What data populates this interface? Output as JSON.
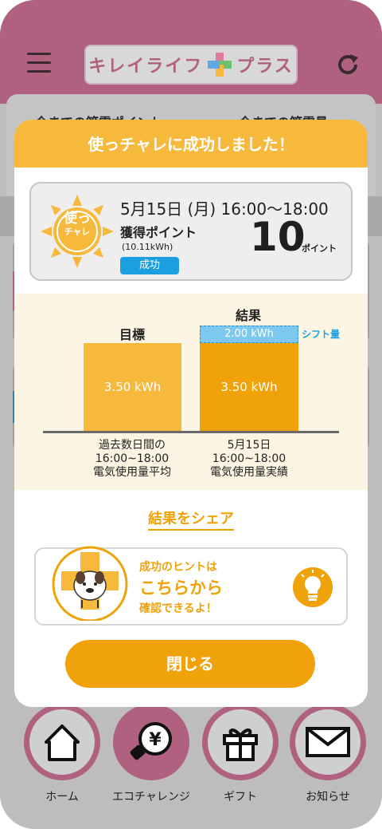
{
  "header": {
    "logo_text_left": "キレイライフ",
    "logo_text_right": "プラス"
  },
  "background": {
    "tab_left": "今までの節電ポイント",
    "tab_right": "今までの節電量"
  },
  "modal": {
    "title": "使っチャレに成功しました！",
    "badge_line1": "使っ",
    "badge_line2": "チャレ",
    "date_time": "5月15日 (月)  16:00〜18:00",
    "points_label": "獲得ポイント",
    "kwh_note": "(10.11kWh)",
    "status": "成功",
    "points_value": "10",
    "points_unit": "ポイント",
    "chart": {
      "target_title": "目標",
      "result_title": "結果",
      "target_value": "3.50 kWh",
      "result_value": "3.50 kWh",
      "shift_value": "2.00 kWh",
      "shift_label": "シフト量",
      "caption_left_1": "過去数日間の",
      "caption_left_2": "16:00~18:00",
      "caption_left_3": "電気使用量平均",
      "caption_right_1": "5月15日",
      "caption_right_2": "16:00~18:00",
      "caption_right_3": "電気使用量実績"
    },
    "share_link": "結果をシェア",
    "hint_line1": "成功のヒントは",
    "hint_line2": "こちらから",
    "hint_line3": "確認できるよ！",
    "close_label": "閉じる"
  },
  "bottom_nav": [
    {
      "label": "ホーム",
      "icon": "home-icon"
    },
    {
      "label": "エコチャレンジ",
      "icon": "yen-bulb-icon"
    },
    {
      "label": "ギフト",
      "icon": "gift-icon"
    },
    {
      "label": "お知らせ",
      "icon": "mail-icon"
    }
  ],
  "colors": {
    "brand_pink": "#b0617f",
    "accent_orange": "#f0a20a",
    "accent_yellow": "#f6b93b",
    "status_blue": "#1c9fe0"
  }
}
